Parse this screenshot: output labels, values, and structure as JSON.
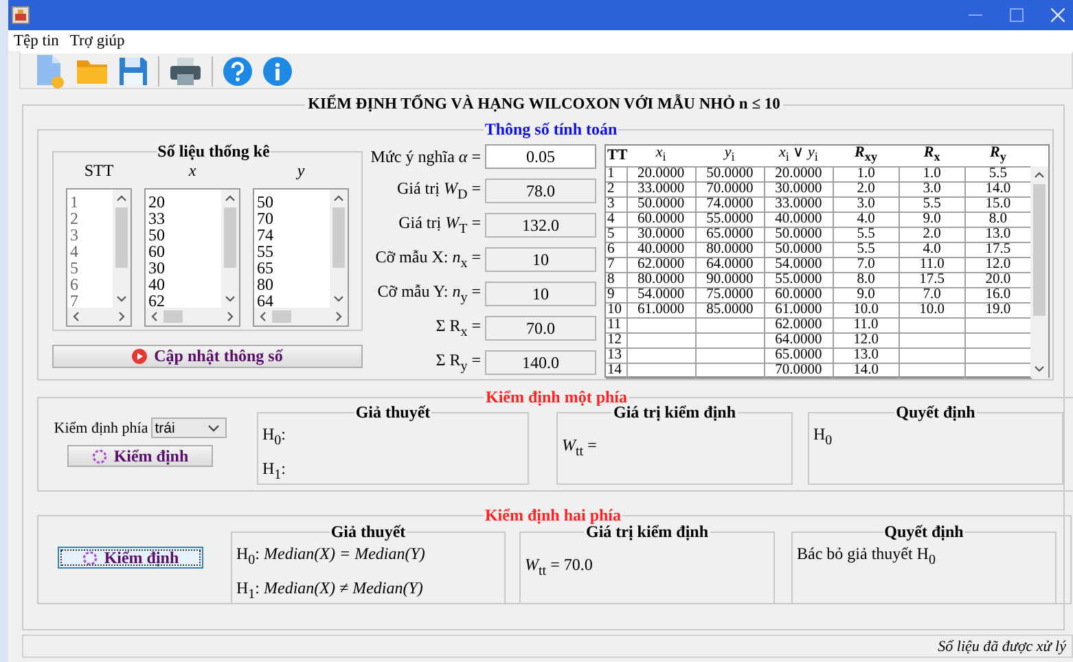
{
  "menu": [
    "Tệp tin",
    "Trợ giúp"
  ],
  "main": {
    "title": "KIỂM ĐỊNH TỔNG VÀ HẠNG WILCOXON VỚI MẪU NHỎ n ≤ 10"
  },
  "compute": {
    "title": "Thông số tính toán",
    "stats": {
      "title": "Số liệu thống kê",
      "lists": [
        {
          "header": "STT",
          "items": [
            "1",
            "2",
            "3",
            "4",
            "5",
            "6",
            "7"
          ]
        },
        {
          "header": "*x*",
          "items": [
            "20",
            "33",
            "50",
            "60",
            "30",
            "40",
            "62"
          ]
        },
        {
          "header": "*y*",
          "items": [
            "50",
            "70",
            "74",
            "55",
            "65",
            "80",
            "64"
          ]
        }
      ]
    },
    "update_button": "Cập nhật thông số",
    "params": [
      {
        "label": "Mức ý nghĩa *α* =",
        "value": "0.05",
        "editable": true
      },
      {
        "label": "Giá trị *W*$_{D}$ =",
        "value": "78.0",
        "editable": false
      },
      {
        "label": "Giá trị *W*$_{T}$ =",
        "value": "132.0",
        "editable": false
      },
      {
        "label": "Cỡ mẫu X: *n*$_{x}$ =",
        "value": "10",
        "editable": false
      },
      {
        "label": "Cỡ mẫu Y: *n*$_{y}$ =",
        "value": "10",
        "editable": false
      },
      {
        "label": "Σ R$_{x}$ =",
        "value": "70.0",
        "editable": false
      },
      {
        "label": "Σ R$_{y}$ =",
        "value": "140.0",
        "editable": false
      }
    ],
    "table": {
      "columns": [
        "TT",
        "*x*$_{i}$",
        "*y*$_{i}$",
        "*x*$_{i}$ ∨ *y*$_{i}$",
        "*R*$_{xy}$",
        "*R*$_{x}$",
        "*R*$_{y}$"
      ],
      "rows": [
        [
          "1",
          "20.0000",
          "50.0000",
          "20.0000",
          "1.0",
          "1.0",
          "5.5"
        ],
        [
          "2",
          "33.0000",
          "70.0000",
          "30.0000",
          "2.0",
          "3.0",
          "14.0"
        ],
        [
          "3",
          "50.0000",
          "74.0000",
          "33.0000",
          "3.0",
          "5.5",
          "15.0"
        ],
        [
          "4",
          "60.0000",
          "55.0000",
          "40.0000",
          "4.0",
          "9.0",
          "8.0"
        ],
        [
          "5",
          "30.0000",
          "65.0000",
          "50.0000",
          "5.5",
          "2.0",
          "13.0"
        ],
        [
          "6",
          "40.0000",
          "80.0000",
          "50.0000",
          "5.5",
          "4.0",
          "17.5"
        ],
        [
          "7",
          "62.0000",
          "64.0000",
          "54.0000",
          "7.0",
          "11.0",
          "12.0"
        ],
        [
          "8",
          "80.0000",
          "90.0000",
          "55.0000",
          "8.0",
          "17.5",
          "20.0"
        ],
        [
          "9",
          "54.0000",
          "75.0000",
          "60.0000",
          "9.0",
          "7.0",
          "16.0"
        ],
        [
          "10",
          "61.0000",
          "85.0000",
          "61.0000",
          "10.0",
          "10.0",
          "19.0"
        ],
        [
          "11",
          null,
          null,
          "62.0000",
          "11.0",
          null,
          null
        ],
        [
          "12",
          null,
          null,
          "64.0000",
          "12.0",
          null,
          null
        ],
        [
          "13",
          null,
          null,
          "65.0000",
          "13.0",
          null,
          null
        ],
        [
          "14",
          null,
          null,
          "70.0000",
          "14.0",
          null,
          null
        ]
      ]
    }
  },
  "one_sided": {
    "title": "Kiểm định một phía",
    "side_label": "Kiểm định phía",
    "side_value": "trái",
    "button": {
      "label": "Kiểm định",
      "focused": false
    },
    "hypothesis": {
      "title": "Giả thuyết",
      "lines": [
        "H$_{0}$:",
        "H$_{1}$:"
      ]
    },
    "test_value": {
      "title": "Giá trị kiểm định",
      "text": "*W*$_{tt}$ ="
    },
    "decision": {
      "title": "Quyết định",
      "text": "H$_{0}$"
    }
  },
  "two_sided": {
    "title": "Kiểm định hai phía",
    "button": {
      "label": "Kiểm định",
      "focused": true
    },
    "hypothesis": {
      "title": "Giả thuyết",
      "lines": [
        "H$_{0}$: *Median(X) = Median(Y)*",
        "H$_{1}$: *Median(X) ≠ Median(Y)*"
      ]
    },
    "test_value": {
      "title": "Giá trị kiểm định",
      "text": "*W*$_{tt}$ = 70.0"
    },
    "decision": {
      "title": "Quyết định",
      "text": "Bác bỏ giả thuyết H$_{0}$"
    }
  },
  "status_bar": "Số liệu đã được xử lý"
}
